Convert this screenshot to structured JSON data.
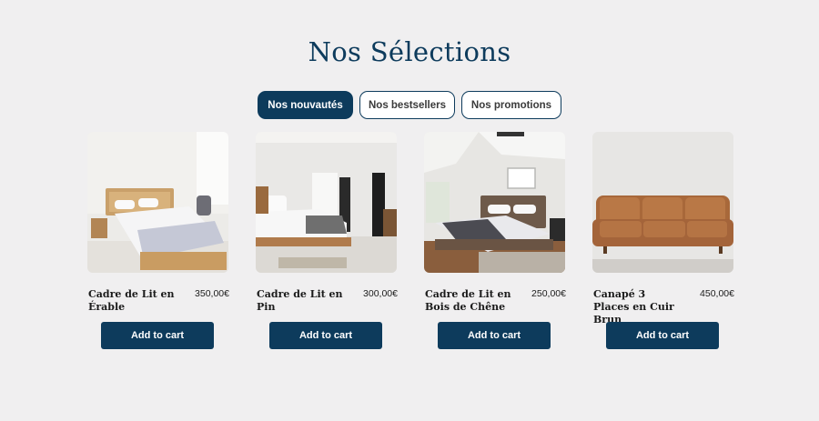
{
  "section": {
    "title": "Nos Sélections"
  },
  "tabs": [
    {
      "label": "Nos nouvautés",
      "active": true
    },
    {
      "label": "Nos bestsellers",
      "active": false
    },
    {
      "label": "Nos promotions",
      "active": false
    }
  ],
  "products": [
    {
      "name": "Cadre de Lit en Érable",
      "price": "350,00€",
      "cta": "Add to cart",
      "image": "maple-bed-photo"
    },
    {
      "name": "Cadre de Lit en Pin",
      "price": "300,00€",
      "cta": "Add to cart",
      "image": "pine-bed-photo"
    },
    {
      "name": "Cadre de Lit en Bois de Chêne",
      "price": "250,00€",
      "cta": "Add to cart",
      "image": "oak-bed-photo"
    },
    {
      "name": "Canapé 3 Places en Cuir Brun",
      "price": "450,00€",
      "cta": "Add to cart",
      "image": "leather-sofa-photo"
    }
  ],
  "colors": {
    "accent": "#0d3b5c",
    "background": "#f0eff0"
  }
}
